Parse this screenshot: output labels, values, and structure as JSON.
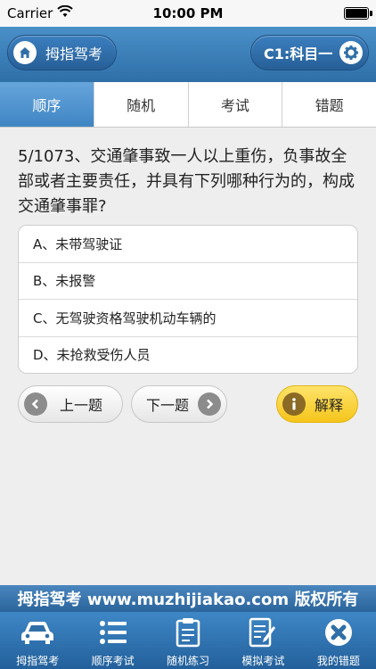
{
  "status_bar": {
    "carrier": "Carrier",
    "time": "10:00 PM"
  },
  "header": {
    "home_label": "拇指驾考",
    "subject_label": "C1:科目一"
  },
  "tabs": [
    {
      "label": "顺序",
      "active": true
    },
    {
      "label": "随机",
      "active": false
    },
    {
      "label": "考试",
      "active": false
    },
    {
      "label": "错题",
      "active": false
    }
  ],
  "question": {
    "text": "5/1073、交通肇事致一人以上重伤，负事故全部或者主要责任，并具有下列哪种行为的，构成交通肇事罪?"
  },
  "options": [
    {
      "label": "A、未带驾驶证"
    },
    {
      "label": "B、未报警"
    },
    {
      "label": "C、无驾驶资格驾驶机动车辆的"
    },
    {
      "label": "D、未抢救受伤人员"
    }
  ],
  "buttons": {
    "prev_label": "上一题",
    "next_label": "下一题",
    "explain_label": "解释"
  },
  "footer": {
    "copyright": "拇指驾考 www.muzhijiakao.com 版权所有"
  },
  "tabbar": {
    "items": [
      {
        "label": "拇指驾考",
        "icon": "car-icon"
      },
      {
        "label": "顺序考试",
        "icon": "list-icon"
      },
      {
        "label": "随机练习",
        "icon": "clipboard-icon"
      },
      {
        "label": "模拟考试",
        "icon": "exam-icon"
      },
      {
        "label": "我的错题",
        "icon": "close-icon"
      }
    ]
  },
  "colors": {
    "accent": "#3f85c3",
    "explain": "#f5c51c",
    "nav": "#2f6fa8"
  }
}
